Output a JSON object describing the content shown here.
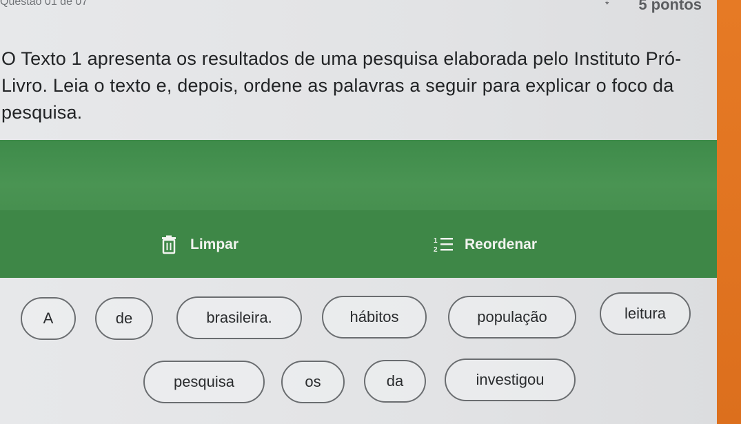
{
  "header": {
    "question_number": "Questão 01 de 07",
    "points": "5 pontos",
    "required_mark": "*"
  },
  "prompt": {
    "text": "O Texto 1 apresenta os resultados de uma pesquisa elaborada pelo Instituto Pró-Livro. Leia o texto e, depois, ordene as palavras a seguir para explicar o foco da pesquisa."
  },
  "toolbar": {
    "clear_label": "Limpar",
    "reorder_label": "Reordenar",
    "clear_icon": "trash-icon",
    "reorder_icon": "numbered-list-icon"
  },
  "words": [
    "A",
    "de",
    "brasileira.",
    "hábitos",
    "população",
    "leitura",
    "pesquisa",
    "os",
    "da",
    "investigou"
  ],
  "colors": {
    "accent_green": "#3e8747",
    "orange_sidebar": "#e67a25"
  }
}
